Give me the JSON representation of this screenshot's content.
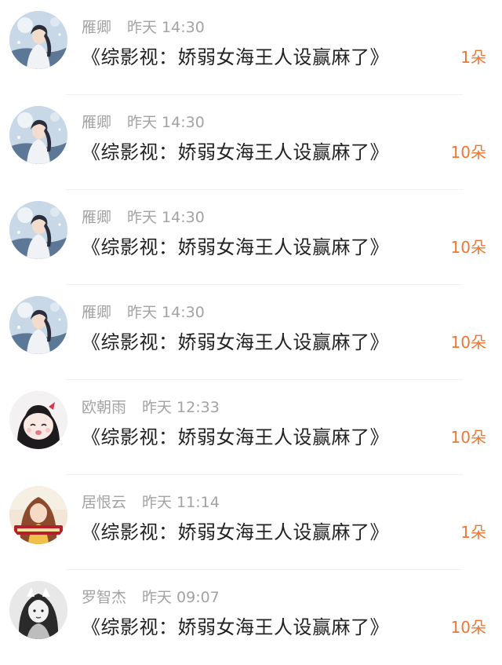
{
  "colors": {
    "meta_text": "#a3a3a3",
    "title_text": "#222222",
    "gift_count": "#f2762e",
    "divider": "#f2f2f2"
  },
  "records": [
    {
      "avatar": "fairy-girl",
      "name": "雁卿",
      "time": "昨天 14:30",
      "title": "《综影视：娇弱女海王人设赢麻了》",
      "gift": "1朵"
    },
    {
      "avatar": "fairy-girl",
      "name": "雁卿",
      "time": "昨天 14:30",
      "title": "《综影视：娇弱女海王人设赢麻了》",
      "gift": "10朵"
    },
    {
      "avatar": "fairy-girl",
      "name": "雁卿",
      "time": "昨天 14:30",
      "title": "《综影视：娇弱女海王人设赢麻了》",
      "gift": "10朵"
    },
    {
      "avatar": "fairy-girl",
      "name": "雁卿",
      "time": "昨天 14:30",
      "title": "《综影视：娇弱女海王人设赢麻了》",
      "gift": "10朵"
    },
    {
      "avatar": "anime-girl",
      "name": "欧朝雨",
      "time": "昨天 12:33",
      "title": "《综影视：娇弱女海王人设赢麻了》",
      "gift": "10朵"
    },
    {
      "avatar": "photo-girl",
      "name": "居恨云",
      "time": "昨天 11:14",
      "title": "《综影视：娇弱女海王人设赢麻了》",
      "gift": "1朵"
    },
    {
      "avatar": "bw-girl",
      "name": "罗智杰",
      "time": "昨天 09:07",
      "title": "《综影视：娇弱女海王人设赢麻了》",
      "gift": "10朵"
    }
  ]
}
